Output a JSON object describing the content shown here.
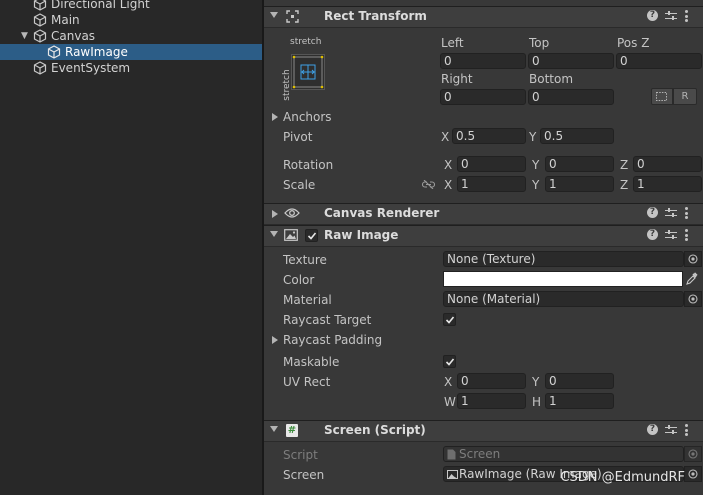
{
  "hierarchy": {
    "items": [
      {
        "label": "Directional Light",
        "indent": 1,
        "selected": false,
        "expanded": null
      },
      {
        "label": "Main",
        "indent": 1,
        "selected": false,
        "expanded": null
      },
      {
        "label": "Canvas",
        "indent": 1,
        "selected": false,
        "expanded": true
      },
      {
        "label": "RawImage",
        "indent": 2,
        "selected": true,
        "expanded": null
      },
      {
        "label": "EventSystem",
        "indent": 1,
        "selected": false,
        "expanded": null
      }
    ]
  },
  "rect_transform": {
    "title": "Rect Transform",
    "anchor_preset_top": "stretch",
    "anchor_preset_side": "stretch",
    "left_label": "Left",
    "left_value": "0",
    "top_label": "Top",
    "top_value": "0",
    "posz_label": "Pos Z",
    "posz_value": "0",
    "right_label": "Right",
    "right_value": "0",
    "bottom_label": "Bottom",
    "bottom_value": "0",
    "raw_edit_label": "R",
    "anchors_label": "Anchors",
    "pivot_label": "Pivot",
    "pivot_x": "0.5",
    "pivot_y": "0.5",
    "rotation_label": "Rotation",
    "rotation_x": "0",
    "rotation_y": "0",
    "rotation_z": "0",
    "scale_label": "Scale",
    "scale_x": "1",
    "scale_y": "1",
    "scale_z": "1",
    "x_label": "X",
    "y_label": "Y",
    "z_label": "Z"
  },
  "canvas_renderer": {
    "title": "Canvas Renderer"
  },
  "raw_image": {
    "title": "Raw Image",
    "enabled": true,
    "texture_label": "Texture",
    "texture_value": "None (Texture)",
    "color_label": "Color",
    "color_value": "#ffffff",
    "material_label": "Material",
    "material_value": "None (Material)",
    "raycast_target_label": "Raycast Target",
    "raycast_target": true,
    "raycast_padding_label": "Raycast Padding",
    "maskable_label": "Maskable",
    "maskable": true,
    "uv_rect_label": "UV Rect",
    "uv_x_label": "X",
    "uv_x": "0",
    "uv_y_label": "Y",
    "uv_y": "0",
    "uv_w_label": "W",
    "uv_w": "1",
    "uv_h_label": "H",
    "uv_h": "1"
  },
  "screen_script": {
    "title": "Screen (Script)",
    "script_label": "Script",
    "script_value": "Screen",
    "screen_label": "Screen",
    "screen_value": "RawImage (Raw Image)"
  },
  "icons": {
    "hierarchy_item": "gameobject-cube-icon",
    "rect_transform": "rect-transform-icon",
    "canvas_renderer": "eye-icon",
    "raw_image": "image-icon",
    "script": "csharp-script-icon",
    "help": "help-icon",
    "presets": "presets-icon",
    "menu": "kebab-menu-icon",
    "object_picker": "object-picker-icon",
    "eyedropper": "eyedropper-icon",
    "constrain": "constrain-proportions-icon"
  },
  "colors": {
    "selection": "#2c5d87",
    "panel": "#383838",
    "field": "#2a2a2a"
  },
  "watermark": "CSDN @EdmundRF"
}
